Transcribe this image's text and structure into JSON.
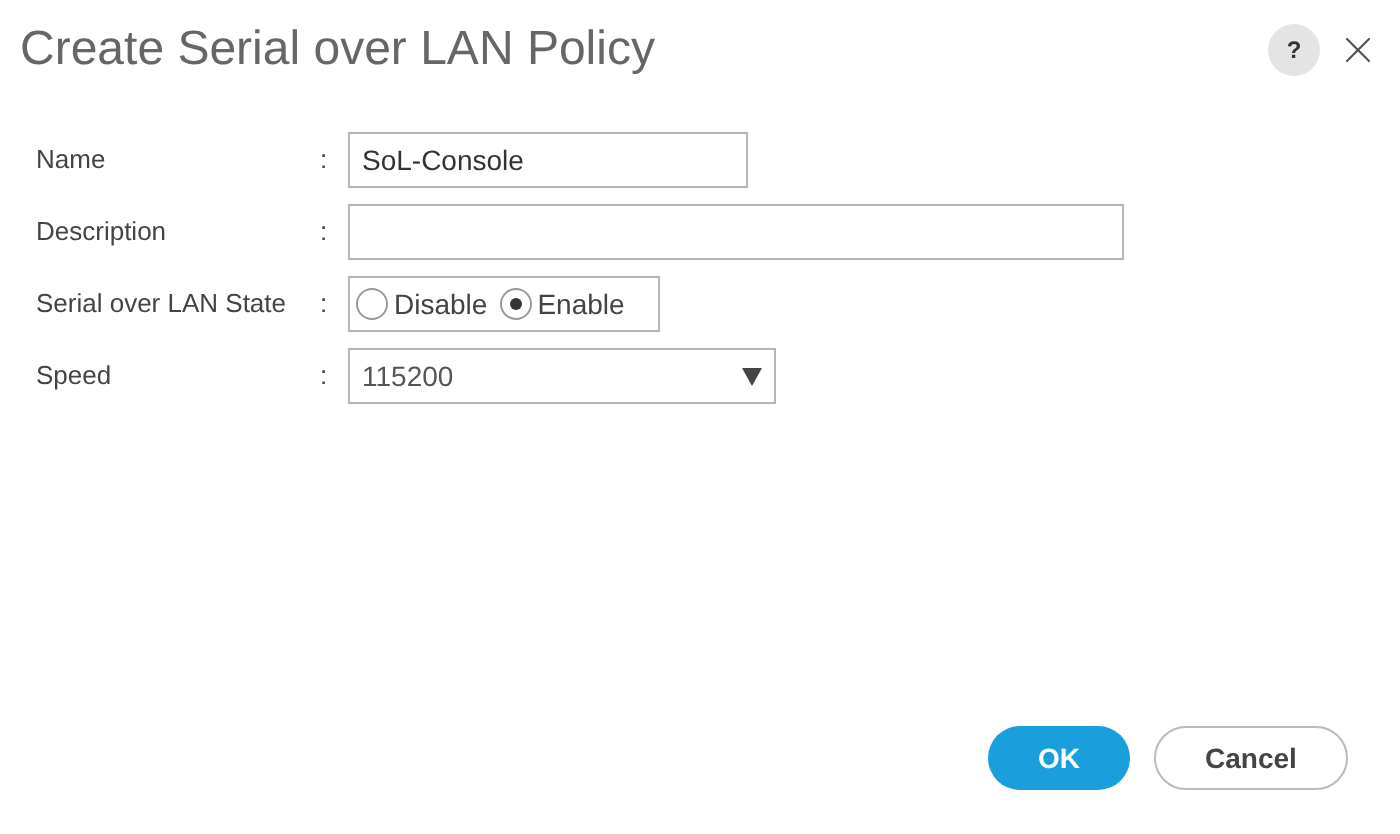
{
  "window": {
    "title": "Create Serial over LAN Policy",
    "help": "?"
  },
  "fields": [
    {
      "kind": "text",
      "label": "Name",
      "separator": ":",
      "value": "SoL-Console"
    },
    {
      "kind": "text",
      "label": "Description",
      "separator": ":"
    },
    {
      "kind": "radio",
      "label": "Serial over LAN State",
      "separator": ":",
      "options": [
        {
          "label": "Disable",
          "selected": false
        },
        {
          "label": "Enable",
          "selected": true
        }
      ]
    },
    {
      "kind": "select",
      "label": "Speed",
      "separator": ":",
      "value": "115200"
    }
  ],
  "buttons": [
    {
      "label": "OK",
      "kind": "primary"
    },
    {
      "label": "Cancel",
      "kind": "secondary"
    }
  ]
}
